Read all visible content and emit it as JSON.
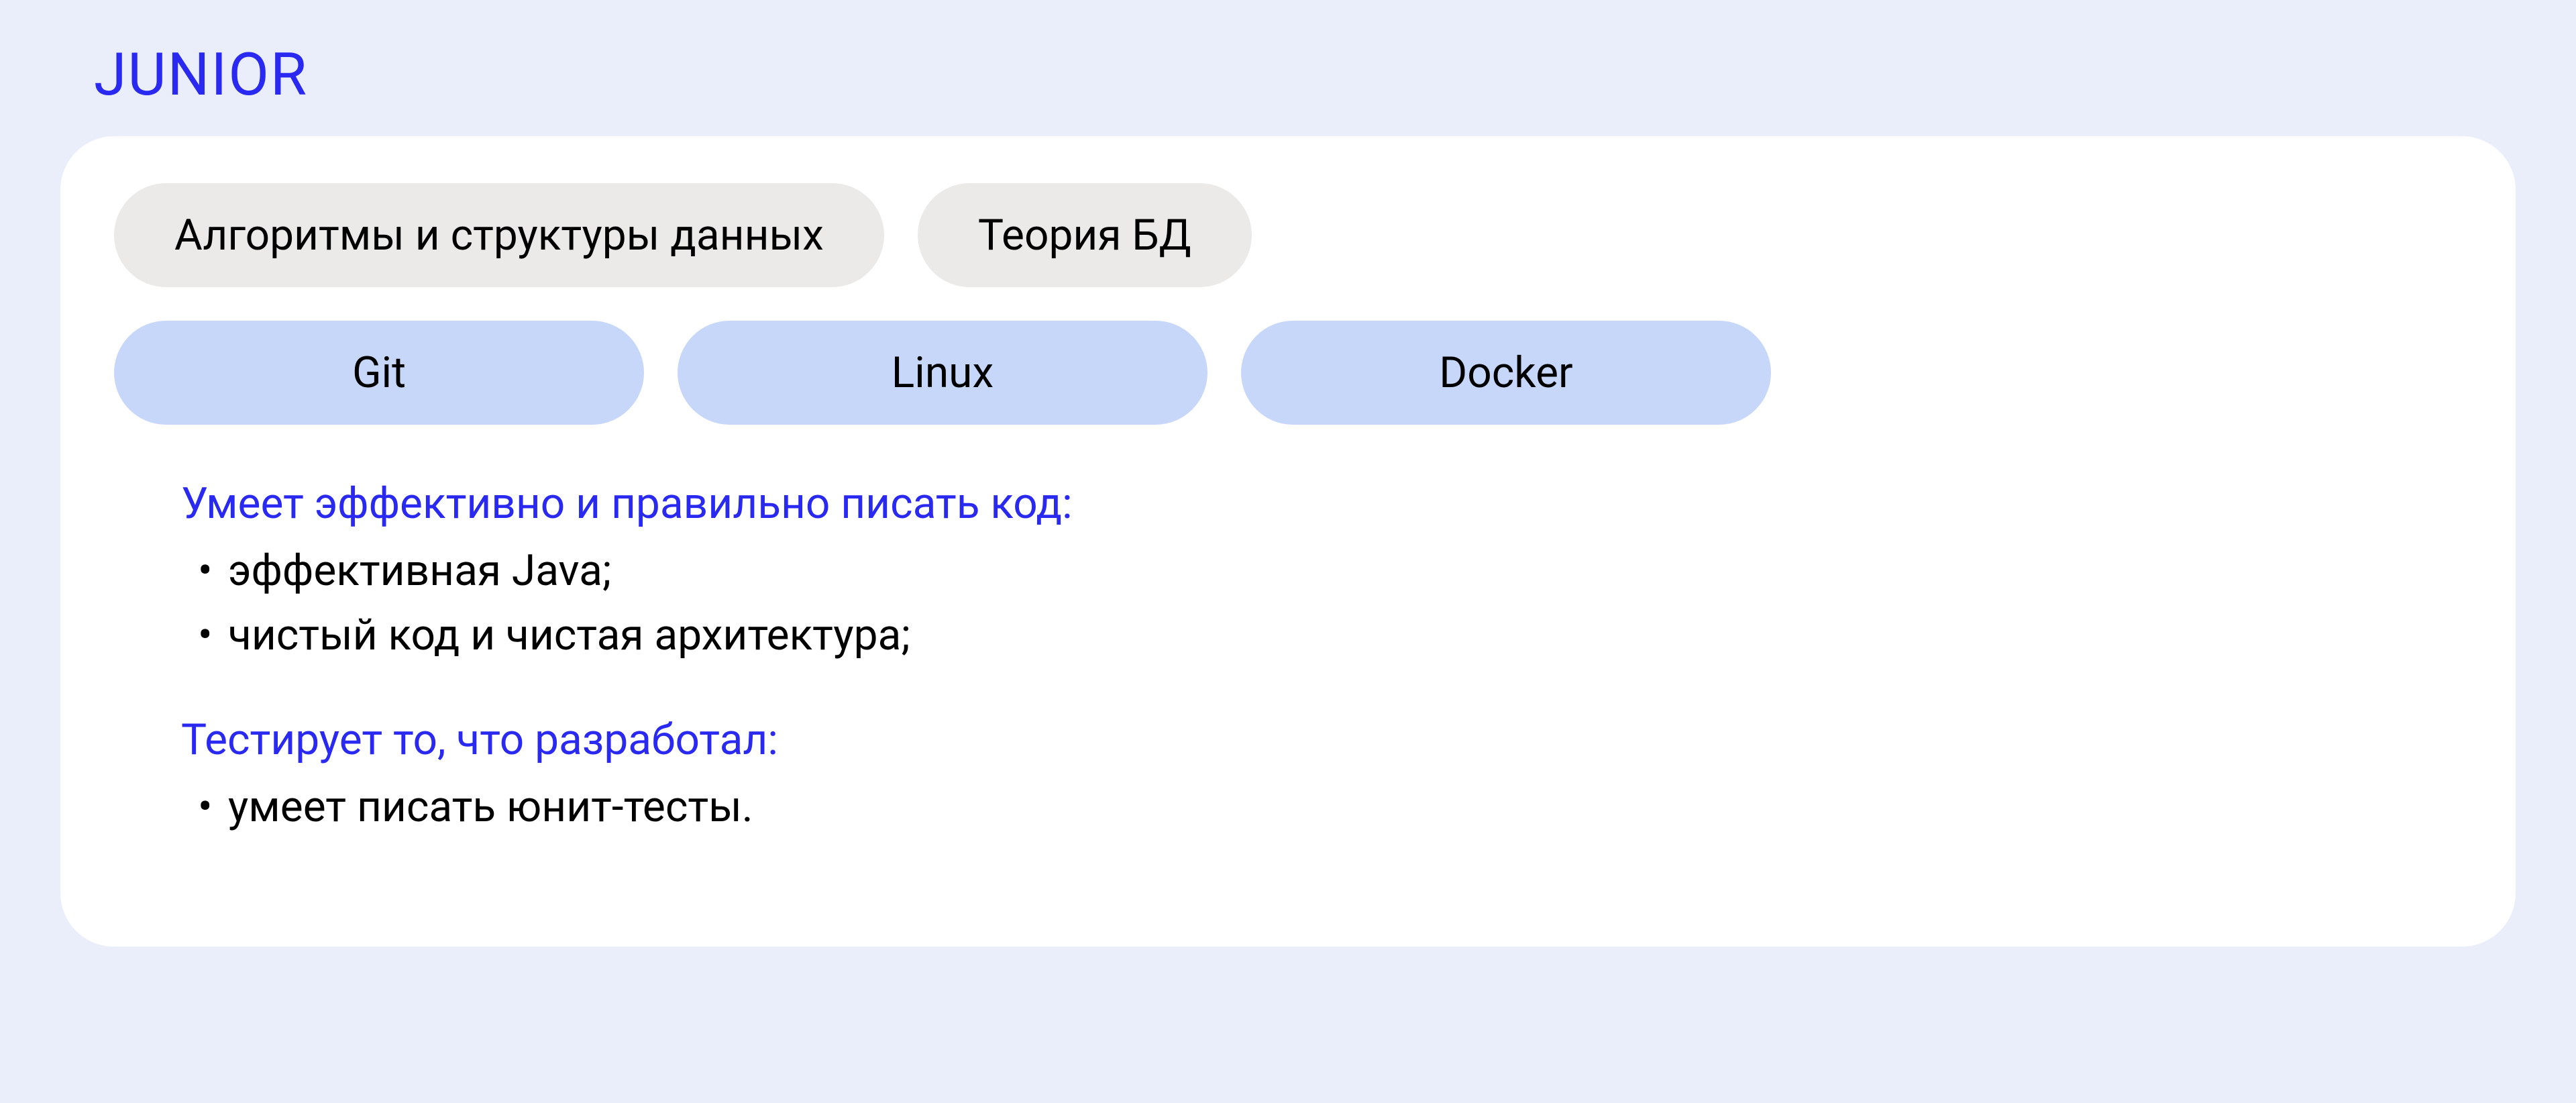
{
  "title": "JUNIOR",
  "pillsRow1": [
    "Алгоритмы и структуры данных",
    "Теория БД"
  ],
  "pillsRow2": [
    "Git",
    "Linux",
    "Docker"
  ],
  "sections": [
    {
      "heading": "Умеет эффективно и правильно писать код:",
      "bullets": [
        "эффективная  Java;",
        "чистый код и чистая архитектура;"
      ]
    },
    {
      "heading": "Тестирует то, что разработал:",
      "bullets": [
        "умеет писать юнит-тесты."
      ]
    }
  ]
}
